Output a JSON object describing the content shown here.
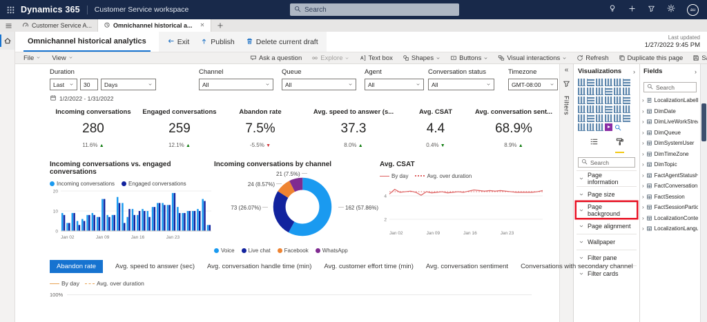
{
  "topbar": {
    "app_name": "Dynamics 365",
    "app_area": "Customer Service workspace",
    "search_placeholder": "Search",
    "avatar_initials": "au"
  },
  "app_tabs": {
    "tab1": "Customer Service A...",
    "tab2": "Omnichannel historical a..."
  },
  "header": {
    "report_tab": "Omnichannel historical analytics",
    "exit": "Exit",
    "publish": "Publish",
    "delete_draft": "Delete current draft",
    "last_updated_label": "Last updated",
    "last_updated_value": "1/27/2022 9:45 PM"
  },
  "menubar": {
    "file": "File",
    "view": "View",
    "tools": [
      {
        "label": "Ask a question",
        "icon": "chat"
      },
      {
        "label": "Explore",
        "icon": "explore",
        "chevron": true,
        "disabled": true
      },
      {
        "label": "Text box",
        "icon": "textbox"
      },
      {
        "label": "Shapes",
        "icon": "shapes",
        "chevron": true
      },
      {
        "label": "Buttons",
        "icon": "buttons",
        "chevron": true
      },
      {
        "label": "Visual interactions",
        "icon": "interactions",
        "chevron": true
      },
      {
        "label": "Refresh",
        "icon": "refresh"
      },
      {
        "label": "Duplicate this page",
        "icon": "duplicate"
      },
      {
        "label": "Save",
        "icon": "save"
      }
    ]
  },
  "filters": {
    "duration": {
      "label": "Duration",
      "mode": "Last",
      "value": "30",
      "unit": "Days"
    },
    "channel": {
      "label": "Channel",
      "value": "All"
    },
    "queue": {
      "label": "Queue",
      "value": "All"
    },
    "agent": {
      "label": "Agent",
      "value": "All"
    },
    "status": {
      "label": "Conversation status",
      "value": "All"
    },
    "timezone": {
      "label": "Timezone",
      "value": "GMT-08:00"
    },
    "date_range": "1/2/2022 - 1/31/2022"
  },
  "kpis": [
    {
      "title": "Incoming conversations",
      "value": "280",
      "delta": "11.6%",
      "direction": "up",
      "delta_color": "green"
    },
    {
      "title": "Engaged conversations",
      "value": "259",
      "delta": "12.1%",
      "direction": "up",
      "delta_color": "green"
    },
    {
      "title": "Abandon rate",
      "value": "7.5%",
      "delta": "-5.5%",
      "direction": "down",
      "delta_color": "red"
    },
    {
      "title": "Avg. speed to answer (s...",
      "value": "37.3",
      "delta": "8.0%",
      "direction": "up",
      "delta_color": "green"
    },
    {
      "title": "Avg. CSAT",
      "value": "4.4",
      "delta": "0.4%",
      "direction": "down",
      "delta_color": "green"
    },
    {
      "title": "Avg. conversation sent...",
      "value": "68.9%",
      "delta": "8.9%",
      "direction": "up",
      "delta_color": "green"
    }
  ],
  "chart_data": [
    {
      "type": "bar",
      "title": "Incoming conversations vs. engaged conversations",
      "x_ticks": [
        "Jan 02",
        "Jan 09",
        "Jan 16",
        "Jan 23"
      ],
      "x_tick_positions": [
        0,
        7,
        14,
        21
      ],
      "ylim": [
        0,
        20
      ],
      "y_ticks": [
        0,
        10,
        20
      ],
      "grid": true,
      "legend_position": "top",
      "series": [
        {
          "name": "Incoming conversations",
          "color": "#1A9AF0",
          "values": [
            9,
            4,
            9,
            5,
            6,
            8,
            9,
            7,
            16,
            8,
            8,
            17,
            14,
            7,
            11,
            8,
            11,
            10,
            12,
            14,
            14,
            13,
            19,
            12,
            9,
            10,
            10,
            11,
            16,
            3
          ]
        },
        {
          "name": "Engaged conversations",
          "color": "#12239E",
          "values": [
            8,
            4,
            9,
            3,
            5,
            8,
            8,
            7,
            16,
            7,
            8,
            14,
            4,
            11,
            8,
            10,
            10,
            7,
            12,
            14,
            13,
            13,
            19,
            9,
            9,
            10,
            10,
            10,
            15,
            3
          ]
        }
      ]
    },
    {
      "type": "donut",
      "title": "Incoming conversations by channel",
      "legend_position": "bottom",
      "slices": [
        {
          "label": "Voice",
          "value": 162,
          "pct": "57.86%",
          "color": "#1A9AF0"
        },
        {
          "label": "Live chat",
          "value": 73,
          "pct": "26.07%",
          "color": "#12239E"
        },
        {
          "label": "Facebook",
          "value": 24,
          "pct": "8.57%",
          "color": "#EE8331"
        },
        {
          "label": "WhatsApp",
          "value": 21,
          "pct": "7.5%",
          "color": "#7F2A90"
        }
      ]
    },
    {
      "type": "line",
      "title": "Avg. CSAT",
      "x_ticks": [
        "Jan 02",
        "Jan 09",
        "Jan 16",
        "Jan 23"
      ],
      "x_tick_positions": [
        0,
        7,
        14,
        21
      ],
      "y_ticks": [
        2,
        4
      ],
      "grid": true,
      "legend_position": "top",
      "series": [
        {
          "name": "By day",
          "style": "solid",
          "color": "#DD5E5E",
          "values": [
            4.15,
            4.55,
            4.3,
            4.35,
            4.4,
            4.3,
            4.05,
            4.35,
            4.25,
            4.3,
            4.35,
            4.25,
            4.3,
            4.35,
            4.3,
            4.4,
            4.5,
            4.45,
            4.4,
            4.45,
            4.4,
            4.45,
            4.4,
            4.35,
            4.3,
            4.3,
            4.3,
            4.3,
            4.35,
            4.45
          ]
        },
        {
          "name": "Avg. over duration",
          "style": "dotted",
          "color": "#DD5E5E",
          "avg_value": 4.35
        }
      ]
    },
    {
      "type": "line",
      "title": "Abandon rate",
      "color": "#E8A253",
      "y_ticks": [
        "100%"
      ],
      "legend": [
        "By day",
        "Avg. over duration"
      ],
      "values": []
    }
  ],
  "bottom_tabs": {
    "active": 0,
    "items": [
      "Abandon rate",
      "Avg. speed to answer (sec)",
      "Avg. conversation handle time (min)",
      "Avg. customer effort time (min)",
      "Avg. conversation sentiment",
      "Conversations with secondary channel"
    ]
  },
  "filters_pane_label": "Filters",
  "viz_pane": {
    "title": "Visualizations",
    "search_placeholder": "Search",
    "visual_types": [
      "stacked-bar-chart",
      "stacked-column-chart",
      "clustered-bar-chart",
      "clustered-column-chart",
      "100-stacked-bar-chart",
      "100-stacked-column-chart",
      "line-chart",
      "area-chart",
      "stacked-area-chart",
      "line-and-stacked-column-chart",
      "line-and-clustered-column-chart",
      "ribbon-chart",
      "waterfall-chart",
      "funnel-chart",
      "scatter-chart",
      "pie-chart",
      "donut-chart",
      "treemap",
      "map",
      "filled-map",
      "shape-map",
      "azure-map",
      "gauge",
      "card",
      "multi-row-card",
      "kpi",
      "slicer",
      "table",
      "matrix",
      "r-script-visual",
      "python-visual",
      "key-influencers",
      "decomposition-tree",
      "power-automate",
      "search"
    ],
    "format_sections": [
      {
        "label": "Page information"
      },
      {
        "label": "Page size"
      },
      {
        "label": "Page background",
        "highlighted": true
      },
      {
        "label": "Page alignment"
      },
      {
        "label": "Wallpaper"
      },
      {
        "label": "Filter pane"
      },
      {
        "label": "Filter cards"
      }
    ]
  },
  "fields_pane": {
    "title": "Fields",
    "search_placeholder": "Search",
    "tables": [
      "LocalizationLabelList",
      "DimDate",
      "DimLiveWorkStream",
      "DimQueue",
      "DimSystemUser",
      "DimTimeZone",
      "DimTopic",
      "FactAgentStatusHistory",
      "FactConversation",
      "FactSession",
      "FactSessionParticipant",
      "LocalizationContentPro...",
      "LocalizationLanguageL..."
    ]
  },
  "colors": {
    "accent_blue": "#1673D0",
    "bar_light": "#1A9AF0",
    "bar_dark": "#12239E",
    "orange": "#EE8331",
    "purple": "#7F2A90",
    "red_line": "#DD5E5E",
    "legend_orange": "#E8A253",
    "green_up": "#107C10",
    "red_down": "#D13438",
    "highlight_red": "#E81123",
    "pbi_yellow": "#F2C811",
    "topbar_navy": "#18294A"
  }
}
